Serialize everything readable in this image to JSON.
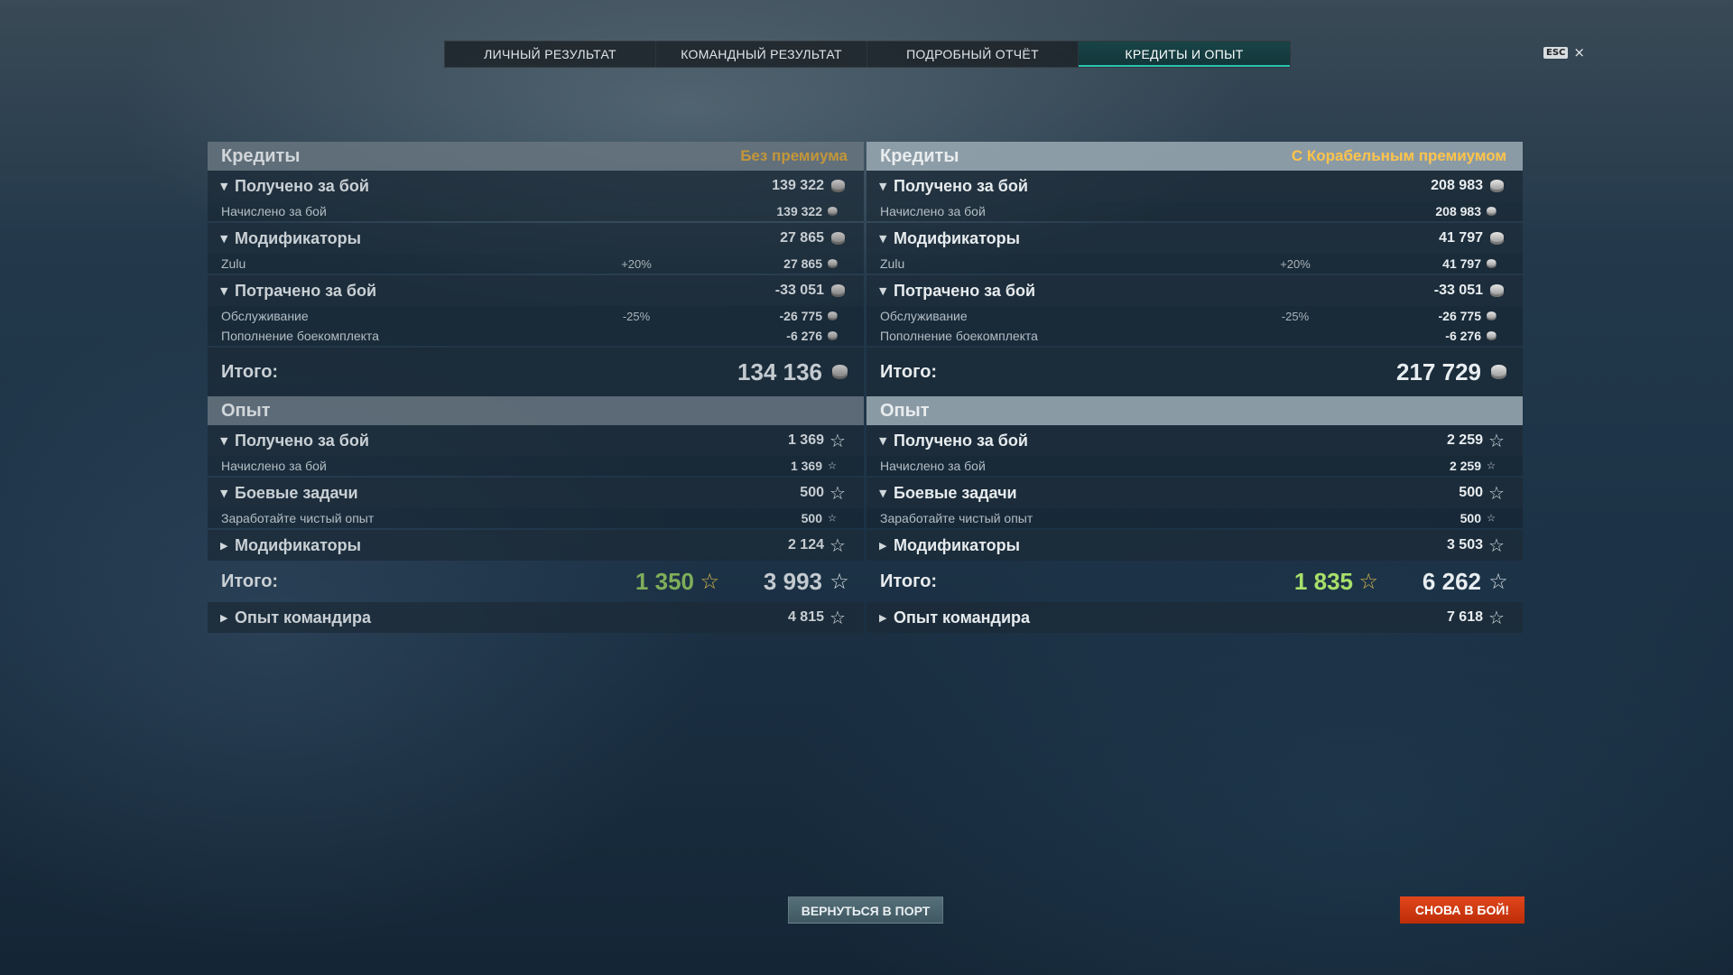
{
  "tabs": [
    {
      "label": "ЛИЧНЫЙ РЕЗУЛЬТАТ",
      "active": false
    },
    {
      "label": "КОМАНДНЫЙ РЕЗУЛЬТАТ",
      "active": false
    },
    {
      "label": "ПОДРОБНЫЙ ОТЧЁТ",
      "active": false
    },
    {
      "label": "КРЕДИТЫ И ОПЫТ",
      "active": true
    }
  ],
  "esc_label": "ESC",
  "close_glyph": "×",
  "left": {
    "credits": {
      "title": "Кредиты",
      "note": "Без премиума",
      "earned": {
        "label": "Получено за бой",
        "value": "139 322"
      },
      "earned_sub": {
        "label": "Начислено за бой",
        "value": "139 322"
      },
      "modifiers": {
        "label": "Модификаторы",
        "value": "27 865"
      },
      "modifiers_sub": {
        "label": "Zulu",
        "mod": "+20%",
        "value": "27 865"
      },
      "spent": {
        "label": "Потрачено за бой",
        "value": "-33 051"
      },
      "service": {
        "label": "Обслуживание",
        "mod": "-25%",
        "value": "-26 775"
      },
      "ammo": {
        "label": "Пополнение боекомплекта",
        "value": "-6 276"
      },
      "total": {
        "label": "Итого:",
        "value": "134 136"
      }
    },
    "exp": {
      "title": "Опыт",
      "earned": {
        "label": "Получено за бой",
        "value": "1 369"
      },
      "earned_sub": {
        "label": "Начислено за бой",
        "value": "1 369"
      },
      "tasks": {
        "label": "Боевые задачи",
        "value": "500"
      },
      "tasks_sub": {
        "label": "Заработайте чистый опыт",
        "value": "500"
      },
      "modifiers": {
        "label": "Модификаторы",
        "value": "2 124"
      },
      "total": {
        "label": "Итого:",
        "free": "1 350",
        "value": "3 993"
      },
      "commander": {
        "label": "Опыт командира",
        "value": "4 815"
      }
    }
  },
  "right": {
    "credits": {
      "title": "Кредиты",
      "note": "С Корабельным премиумом",
      "earned": {
        "label": "Получено за бой",
        "value": "208 983"
      },
      "earned_sub": {
        "label": "Начислено за бой",
        "value": "208 983"
      },
      "modifiers": {
        "label": "Модификаторы",
        "value": "41 797"
      },
      "modifiers_sub": {
        "label": "Zulu",
        "mod": "+20%",
        "value": "41 797"
      },
      "spent": {
        "label": "Потрачено за бой",
        "value": "-33 051"
      },
      "service": {
        "label": "Обслуживание",
        "mod": "-25%",
        "value": "-26 775"
      },
      "ammo": {
        "label": "Пополнение боекомплекта",
        "value": "-6 276"
      },
      "total": {
        "label": "Итого:",
        "value": "217 729"
      }
    },
    "exp": {
      "title": "Опыт",
      "earned": {
        "label": "Получено за бой",
        "value": "2 259"
      },
      "earned_sub": {
        "label": "Начислено за бой",
        "value": "2 259"
      },
      "tasks": {
        "label": "Боевые задачи",
        "value": "500"
      },
      "tasks_sub": {
        "label": "Заработайте чистый опыт",
        "value": "500"
      },
      "modifiers": {
        "label": "Модификаторы",
        "value": "3 503"
      },
      "total": {
        "label": "Итого:",
        "free": "1 835",
        "value": "6 262"
      },
      "commander": {
        "label": "Опыт командира",
        "value": "7 618"
      }
    }
  },
  "buttons": {
    "port": "ВЕРНУТЬСЯ В ПОРТ",
    "battle": "СНОВА В БОЙ!"
  },
  "icons": {
    "credit": "credit-coin-icon",
    "xp": "star-icon",
    "expanded": "triangle-down-icon",
    "collapsed": "triangle-right-icon"
  },
  "colors": {
    "active_tab_accent": "#2ac3b0",
    "premium_note": "#ffc44a",
    "free_xp": "#a8e06a",
    "battle_button": "#d23a12"
  }
}
